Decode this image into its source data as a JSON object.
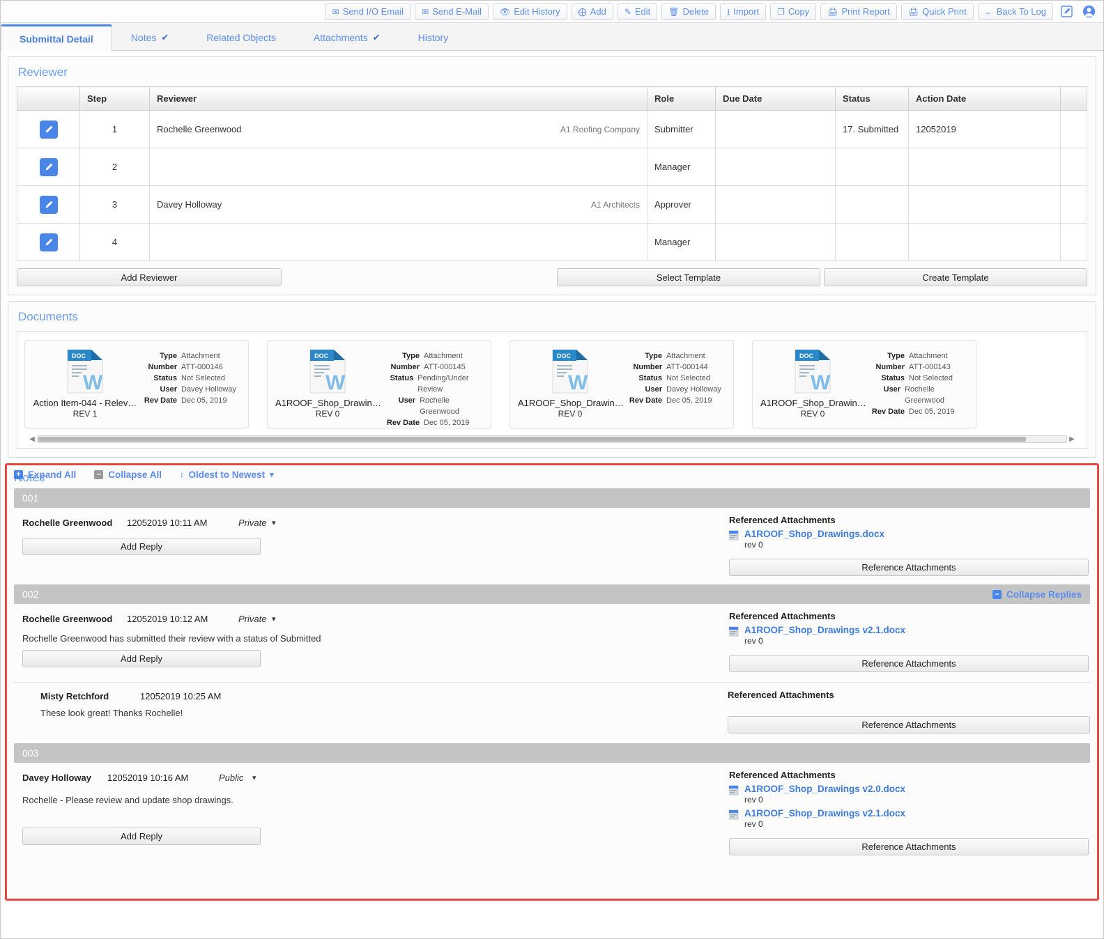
{
  "toolbar": {
    "buttons": [
      {
        "label": "Send I/O Email",
        "icon": "envelope-icon"
      },
      {
        "label": "Send E-Mail",
        "icon": "envelope-icon"
      },
      {
        "label": "Edit History",
        "icon": "eye-icon"
      },
      {
        "label": "Add",
        "icon": "plus-circle-icon"
      },
      {
        "label": "Edit",
        "icon": "pencil-icon"
      },
      {
        "label": "Delete",
        "icon": "trash-icon"
      },
      {
        "label": "Import",
        "icon": "download-icon"
      },
      {
        "label": "Copy",
        "icon": "copy-icon"
      },
      {
        "label": "Print Report",
        "icon": "printer-icon"
      },
      {
        "label": "Quick Print",
        "icon": "printer-icon"
      },
      {
        "label": "Back To Log",
        "icon": "arrow-left-icon"
      }
    ],
    "compose_icon": "compose-icon",
    "account_icon": "user-account-icon"
  },
  "tabs": [
    {
      "label": "Submittal Detail",
      "active": true,
      "check": false
    },
    {
      "label": "Notes",
      "active": false,
      "check": true
    },
    {
      "label": "Related Objects",
      "active": false,
      "check": false
    },
    {
      "label": "Attachments",
      "active": false,
      "check": true
    },
    {
      "label": "History",
      "active": false,
      "check": false
    }
  ],
  "reviewer": {
    "title": "Reviewer",
    "columns": [
      "",
      "Step",
      "Reviewer",
      "Role",
      "Due Date",
      "Status",
      "Action Date",
      ""
    ],
    "rows": [
      {
        "step": "1",
        "reviewer": "Rochelle Greenwood",
        "org": "A1 Roofing Company",
        "role": "Submitter",
        "due_date": "",
        "status": "17. Submitted",
        "action_date": "12052019"
      },
      {
        "step": "2",
        "reviewer": "",
        "org": "",
        "role": "Manager",
        "due_date": "",
        "status": "",
        "action_date": ""
      },
      {
        "step": "3",
        "reviewer": "Davey Holloway",
        "org": "A1 Architects",
        "role": "Approver",
        "due_date": "",
        "status": "",
        "action_date": ""
      },
      {
        "step": "4",
        "reviewer": "",
        "org": "",
        "role": "Manager",
        "due_date": "",
        "status": "",
        "action_date": ""
      }
    ],
    "add_reviewer_label": "Add Reviewer",
    "select_template_label": "Select Template",
    "create_template_label": "Create Template"
  },
  "documents": {
    "title": "Documents",
    "field_labels": {
      "type": "Type",
      "number": "Number",
      "status": "Status",
      "user": "User",
      "rev_date": "Rev Date"
    },
    "cards": [
      {
        "name": "Action Item-044 - Relev…",
        "rev": "REV  1",
        "type": "Attachment",
        "number": "ATT-000146",
        "status": "Not Selected",
        "user": "Davey Holloway",
        "rev_date": "Dec 05, 2019",
        "icon": "word-doc-icon"
      },
      {
        "name": "A1ROOF_Shop_Drawin…",
        "rev": "REV  0",
        "type": "Attachment",
        "number": "ATT-000145",
        "status": "Pending/Under Review",
        "user": "Rochelle Greenwood",
        "rev_date": "Dec 05, 2019",
        "icon": "word-doc-icon"
      },
      {
        "name": "A1ROOF_Shop_Drawin…",
        "rev": "REV  0",
        "type": "Attachment",
        "number": "ATT-000144",
        "status": "Not Selected",
        "user": "Davey Holloway",
        "rev_date": "Dec 05, 2019",
        "icon": "word-doc-icon"
      },
      {
        "name": "A1ROOF_Shop_Drawin…",
        "rev": "REV  0",
        "type": "Attachment",
        "number": "ATT-000143",
        "status": "Not Selected",
        "user": "Rochelle Greenwood",
        "rev_date": "Dec 05, 2019",
        "icon": "word-doc-icon"
      }
    ]
  },
  "notes": {
    "title": "Notes",
    "expand_all_label": "Expand All",
    "collapse_all_label": "Collapse All",
    "sort_label": "Oldest to Newest",
    "referenced_attachments_label": "Referenced Attachments",
    "reference_attachments_button": "Reference Attachments",
    "add_reply_label": "Add Reply",
    "collapse_replies_label": "Collapse Replies",
    "items": [
      {
        "number": "001",
        "author": "Rochelle Greenwood",
        "timestamp": "12052019 10:11 AM",
        "visibility": "Private",
        "text": "",
        "attachments": [
          {
            "name": "A1ROOF_Shop_Drawings.docx",
            "rev": "rev 0"
          }
        ],
        "replies": []
      },
      {
        "number": "002",
        "author": "Rochelle Greenwood",
        "timestamp": "12052019 10:12 AM",
        "visibility": "Private",
        "text": "Rochelle Greenwood has submitted their review with a status of Submitted",
        "attachments": [
          {
            "name": "A1ROOF_Shop_Drawings v2.1.docx",
            "rev": "rev 0"
          }
        ],
        "has_collapse_replies": true,
        "replies": [
          {
            "author": "Misty Retchford",
            "timestamp": "12052019 10:25 AM",
            "text": "These look great! Thanks Rochelle!",
            "attachments": []
          }
        ]
      },
      {
        "number": "003",
        "author": "Davey Holloway",
        "timestamp": "12052019 10:16 AM",
        "visibility": "Public",
        "text": "Rochelle - Please review and update shop drawings.",
        "attachments": [
          {
            "name": "A1ROOF_Shop_Drawings v2.0.docx",
            "rev": "rev 0"
          },
          {
            "name": "A1ROOF_Shop_Drawings v2.1.docx",
            "rev": "rev 0"
          }
        ],
        "replies": []
      }
    ]
  },
  "colors": {
    "accent": "#5b8def",
    "highlight_border": "#e8453c",
    "note_bar": "#c4c4c4",
    "edit_button": "#4a86e8"
  }
}
